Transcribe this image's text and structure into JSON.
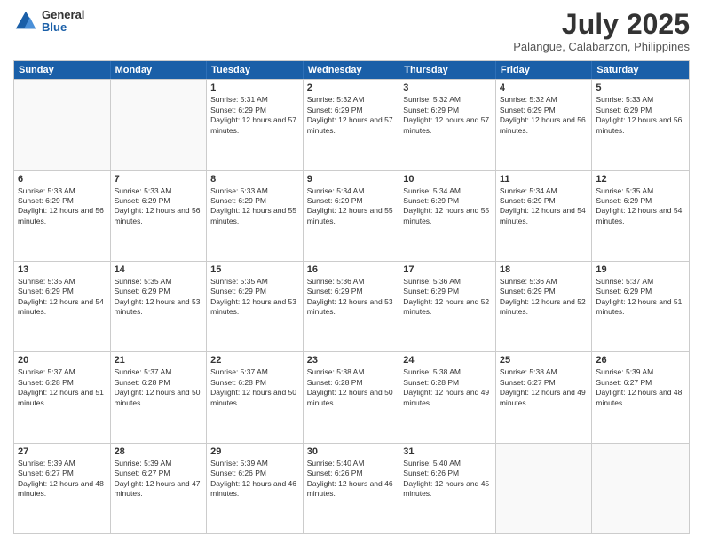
{
  "header": {
    "logo_general": "General",
    "logo_blue": "Blue",
    "month_year": "July 2025",
    "location": "Palangue, Calabarzon, Philippines"
  },
  "weekdays": [
    "Sunday",
    "Monday",
    "Tuesday",
    "Wednesday",
    "Thursday",
    "Friday",
    "Saturday"
  ],
  "rows": [
    [
      {
        "day": "",
        "info": ""
      },
      {
        "day": "",
        "info": ""
      },
      {
        "day": "1",
        "info": "Sunrise: 5:31 AM\nSunset: 6:29 PM\nDaylight: 12 hours and 57 minutes."
      },
      {
        "day": "2",
        "info": "Sunrise: 5:32 AM\nSunset: 6:29 PM\nDaylight: 12 hours and 57 minutes."
      },
      {
        "day": "3",
        "info": "Sunrise: 5:32 AM\nSunset: 6:29 PM\nDaylight: 12 hours and 57 minutes."
      },
      {
        "day": "4",
        "info": "Sunrise: 5:32 AM\nSunset: 6:29 PM\nDaylight: 12 hours and 56 minutes."
      },
      {
        "day": "5",
        "info": "Sunrise: 5:33 AM\nSunset: 6:29 PM\nDaylight: 12 hours and 56 minutes."
      }
    ],
    [
      {
        "day": "6",
        "info": "Sunrise: 5:33 AM\nSunset: 6:29 PM\nDaylight: 12 hours and 56 minutes."
      },
      {
        "day": "7",
        "info": "Sunrise: 5:33 AM\nSunset: 6:29 PM\nDaylight: 12 hours and 56 minutes."
      },
      {
        "day": "8",
        "info": "Sunrise: 5:33 AM\nSunset: 6:29 PM\nDaylight: 12 hours and 55 minutes."
      },
      {
        "day": "9",
        "info": "Sunrise: 5:34 AM\nSunset: 6:29 PM\nDaylight: 12 hours and 55 minutes."
      },
      {
        "day": "10",
        "info": "Sunrise: 5:34 AM\nSunset: 6:29 PM\nDaylight: 12 hours and 55 minutes."
      },
      {
        "day": "11",
        "info": "Sunrise: 5:34 AM\nSunset: 6:29 PM\nDaylight: 12 hours and 54 minutes."
      },
      {
        "day": "12",
        "info": "Sunrise: 5:35 AM\nSunset: 6:29 PM\nDaylight: 12 hours and 54 minutes."
      }
    ],
    [
      {
        "day": "13",
        "info": "Sunrise: 5:35 AM\nSunset: 6:29 PM\nDaylight: 12 hours and 54 minutes."
      },
      {
        "day": "14",
        "info": "Sunrise: 5:35 AM\nSunset: 6:29 PM\nDaylight: 12 hours and 53 minutes."
      },
      {
        "day": "15",
        "info": "Sunrise: 5:35 AM\nSunset: 6:29 PM\nDaylight: 12 hours and 53 minutes."
      },
      {
        "day": "16",
        "info": "Sunrise: 5:36 AM\nSunset: 6:29 PM\nDaylight: 12 hours and 53 minutes."
      },
      {
        "day": "17",
        "info": "Sunrise: 5:36 AM\nSunset: 6:29 PM\nDaylight: 12 hours and 52 minutes."
      },
      {
        "day": "18",
        "info": "Sunrise: 5:36 AM\nSunset: 6:29 PM\nDaylight: 12 hours and 52 minutes."
      },
      {
        "day": "19",
        "info": "Sunrise: 5:37 AM\nSunset: 6:29 PM\nDaylight: 12 hours and 51 minutes."
      }
    ],
    [
      {
        "day": "20",
        "info": "Sunrise: 5:37 AM\nSunset: 6:28 PM\nDaylight: 12 hours and 51 minutes."
      },
      {
        "day": "21",
        "info": "Sunrise: 5:37 AM\nSunset: 6:28 PM\nDaylight: 12 hours and 50 minutes."
      },
      {
        "day": "22",
        "info": "Sunrise: 5:37 AM\nSunset: 6:28 PM\nDaylight: 12 hours and 50 minutes."
      },
      {
        "day": "23",
        "info": "Sunrise: 5:38 AM\nSunset: 6:28 PM\nDaylight: 12 hours and 50 minutes."
      },
      {
        "day": "24",
        "info": "Sunrise: 5:38 AM\nSunset: 6:28 PM\nDaylight: 12 hours and 49 minutes."
      },
      {
        "day": "25",
        "info": "Sunrise: 5:38 AM\nSunset: 6:27 PM\nDaylight: 12 hours and 49 minutes."
      },
      {
        "day": "26",
        "info": "Sunrise: 5:39 AM\nSunset: 6:27 PM\nDaylight: 12 hours and 48 minutes."
      }
    ],
    [
      {
        "day": "27",
        "info": "Sunrise: 5:39 AM\nSunset: 6:27 PM\nDaylight: 12 hours and 48 minutes."
      },
      {
        "day": "28",
        "info": "Sunrise: 5:39 AM\nSunset: 6:27 PM\nDaylight: 12 hours and 47 minutes."
      },
      {
        "day": "29",
        "info": "Sunrise: 5:39 AM\nSunset: 6:26 PM\nDaylight: 12 hours and 46 minutes."
      },
      {
        "day": "30",
        "info": "Sunrise: 5:40 AM\nSunset: 6:26 PM\nDaylight: 12 hours and 46 minutes."
      },
      {
        "day": "31",
        "info": "Sunrise: 5:40 AM\nSunset: 6:26 PM\nDaylight: 12 hours and 45 minutes."
      },
      {
        "day": "",
        "info": ""
      },
      {
        "day": "",
        "info": ""
      }
    ]
  ]
}
